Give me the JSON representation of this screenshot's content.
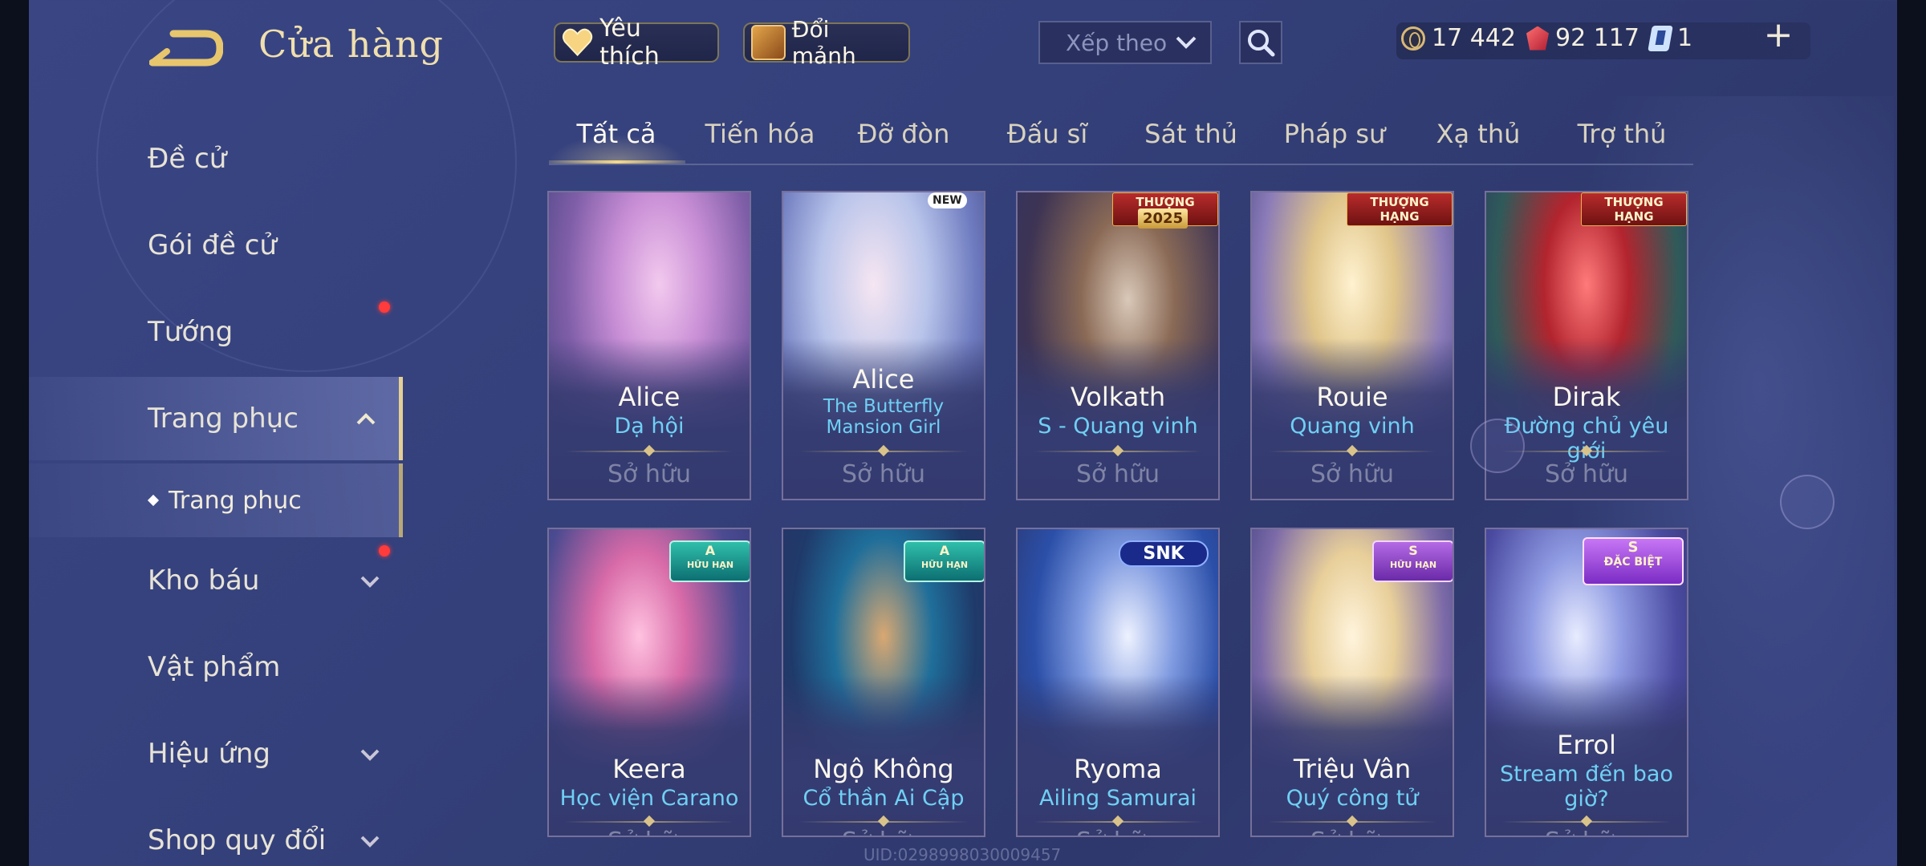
{
  "header": {
    "title": "Cửa hàng",
    "favorites_label": "Yêu thích",
    "fragment_label": "Đổi mảnh",
    "sort_label": "Xếp theo"
  },
  "currency": {
    "gold": "17 442",
    "ruby": "92 117",
    "voucher": "1"
  },
  "sidebar": {
    "items": [
      {
        "label": "Đề cử"
      },
      {
        "label": "Gói đề cử"
      },
      {
        "label": "Tướng"
      },
      {
        "label": "Trang phục"
      },
      {
        "label": "Trang phục"
      },
      {
        "label": "Kho báu"
      },
      {
        "label": "Vật phẩm"
      },
      {
        "label": "Hiệu ứng"
      },
      {
        "label": "Shop quy đổi"
      }
    ]
  },
  "tabs": [
    {
      "label": "Tất cả"
    },
    {
      "label": "Tiến hóa"
    },
    {
      "label": "Đỡ đòn"
    },
    {
      "label": "Đấu sĩ"
    },
    {
      "label": "Sát thủ"
    },
    {
      "label": "Pháp sư"
    },
    {
      "label": "Xạ thủ"
    },
    {
      "label": "Trợ thủ"
    }
  ],
  "cards": [
    {
      "hero": "Alice",
      "skin": "Dạ hội",
      "status": "Sở hữu",
      "accent": "#c98fd6"
    },
    {
      "hero": "Alice",
      "skin": "The Butterfly Mansion Girl",
      "status": "Sở hữu",
      "accent": "#8fa4d8",
      "badge": "NEW"
    },
    {
      "hero": "Volkath",
      "skin": "S - Quang vinh",
      "status": "Sở hữu",
      "accent": "#6a5040",
      "badge": "THƯỢNG HẠNG",
      "badge2": "2025"
    },
    {
      "hero": "Rouie",
      "skin": "Quang vinh",
      "status": "Sở hữu",
      "accent": "#c6a86a",
      "badge": "THƯỢNG HẠNG"
    },
    {
      "hero": "Dirak",
      "skin": "Đường chủ yêu giới",
      "status": "Sở hữu",
      "accent": "#b3242e",
      "badge": "THƯỢNG HẠNG"
    },
    {
      "hero": "Keera",
      "skin": "Học viện Carano",
      "status": "Sở hữu",
      "accent": "#d86aa8",
      "tier": "A",
      "tier_sub": "HỮU HẠN"
    },
    {
      "hero": "Ngộ Không",
      "skin": "Cổ thần Ai Cập",
      "status": "Sở hữu",
      "accent": "#1f6e9a",
      "tier": "A",
      "tier_sub": "HỮU HẠN"
    },
    {
      "hero": "Ryoma",
      "skin": "Ailing Samurai",
      "status": "Sở hữu",
      "accent": "#2b4fa8",
      "badge": "SNK"
    },
    {
      "hero": "Triệu Vân",
      "skin": "Quý công tử",
      "status": "Sở hữu",
      "accent": "#d9b46a",
      "tier": "S",
      "tier_sub": "HỮU HẠN"
    },
    {
      "hero": "Errol",
      "skin": "Stream đến bao giờ?",
      "status": "Sở hữu",
      "accent": "#6a7ad0",
      "tier": "S",
      "tier_sub": "ĐẶC BIỆT"
    }
  ],
  "footer": {
    "uid": "UID:0298998030009457"
  }
}
